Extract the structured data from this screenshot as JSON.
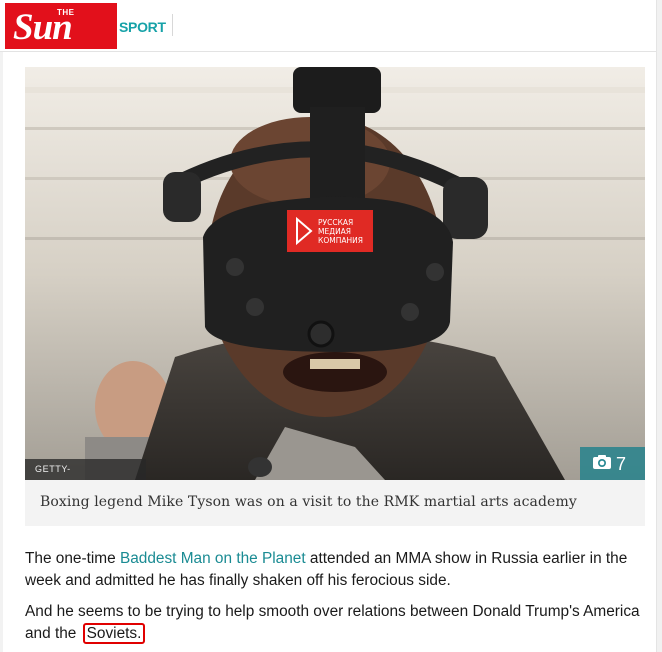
{
  "header": {
    "logo_the": "THE",
    "logo_sun": "Sun",
    "section": "SPORT"
  },
  "photo": {
    "credit": "GETTY- CONTRIBUTOR",
    "gallery_count": "7",
    "headset_logo_lines": [
      "РУССКАЯ",
      "МЕДИАЯ",
      "КОМПАНИЯ"
    ],
    "caption": "Boxing legend Mike Tyson was on a visit to the RMK martial arts academy"
  },
  "article": {
    "p1_before": "The one-time ",
    "p1_link": "Baddest Man on the Planet",
    "p1_after": " attended an MMA show in Russia earlier in the week and admitted he has finally shaken off his ferocious side.",
    "p2_before": "And he seems to be trying to help smooth over relations between Donald Trump's America and the ",
    "p2_highlight": "Soviets."
  },
  "colors": {
    "brand_red": "#e2101b",
    "accent_teal": "#17a2a8",
    "link_teal": "#1a8b93",
    "highlight_box": "#e00000"
  }
}
